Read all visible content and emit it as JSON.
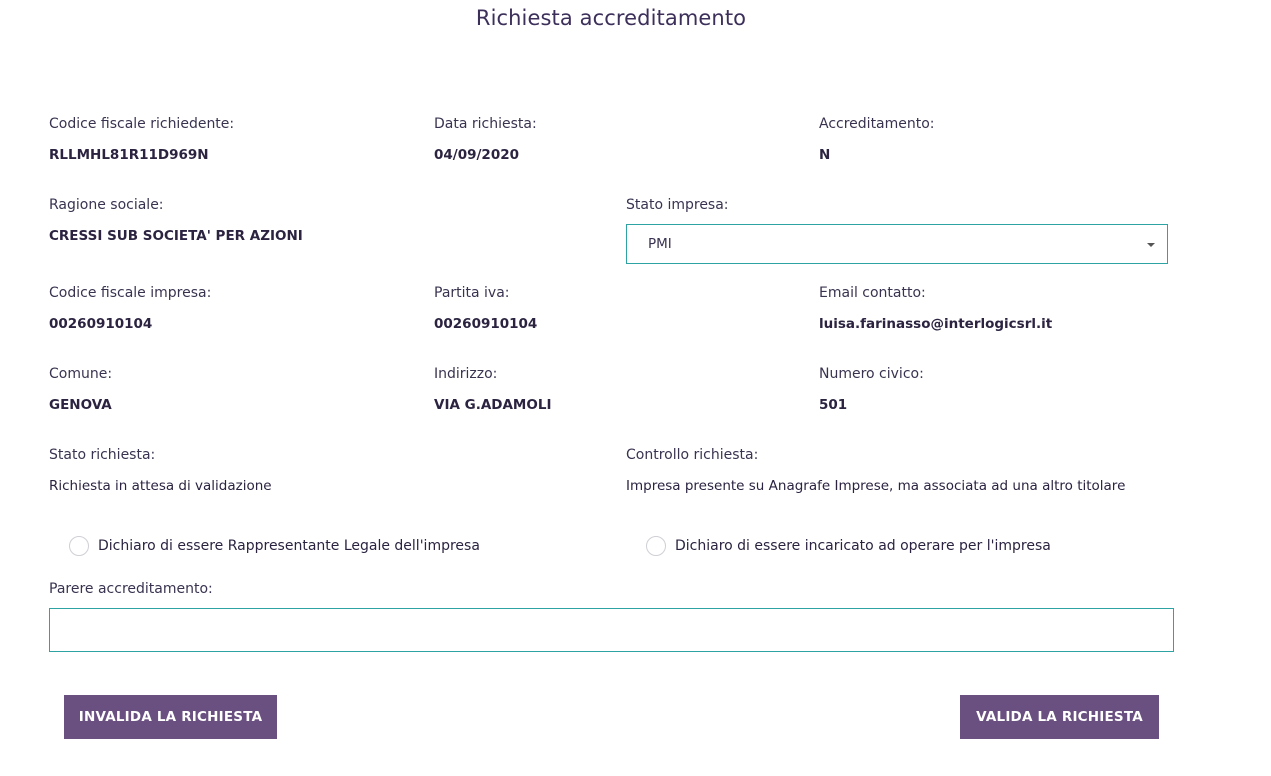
{
  "page": {
    "title": "Richiesta accreditamento"
  },
  "fields": {
    "codice_fiscale_richiedente": {
      "label": "Codice fiscale richiedente:",
      "value": "RLLMHL81R11D969N"
    },
    "data_richiesta": {
      "label": "Data richiesta:",
      "value": "04/09/2020"
    },
    "accreditamento": {
      "label": "Accreditamento:",
      "value": "N"
    },
    "ragione_sociale": {
      "label": "Ragione sociale:",
      "value": "CRESSI SUB SOCIETA' PER AZIONI"
    },
    "stato_impresa": {
      "label": "Stato impresa:",
      "value": "PMI"
    },
    "codice_fiscale_impresa": {
      "label": "Codice fiscale impresa:",
      "value": "00260910104"
    },
    "partita_iva": {
      "label": "Partita iva:",
      "value": "00260910104"
    },
    "email_contatto": {
      "label": "Email contatto:",
      "value": "luisa.farinasso@interlogicsrl.it"
    },
    "comune": {
      "label": "Comune:",
      "value": "GENOVA"
    },
    "indirizzo": {
      "label": "Indirizzo:",
      "value": "VIA G.ADAMOLI"
    },
    "numero_civico": {
      "label": "Numero civico:",
      "value": "501"
    },
    "stato_richiesta": {
      "label": "Stato richiesta:",
      "value": "Richiesta in attesa di validazione"
    },
    "controllo_richiesta": {
      "label": "Controllo richiesta:",
      "value": "Impresa presente su Anagrafe Imprese, ma associata ad una altro titolare"
    }
  },
  "radios": {
    "rappresentante": {
      "label": "Dichiaro di essere Rappresentante Legale dell'impresa"
    },
    "incaricato": {
      "label": "Dichiaro di essere incaricato ad operare per l'impresa"
    }
  },
  "parere": {
    "label": "Parere accreditamento:",
    "value": ""
  },
  "buttons": {
    "invalida": "INVALIDA LA RICHIESTA",
    "valida": "VALIDA LA RICHIESTA"
  },
  "colors": {
    "accent": "#2ea3a3",
    "button": "#6a5081",
    "text": "#2b2340"
  }
}
